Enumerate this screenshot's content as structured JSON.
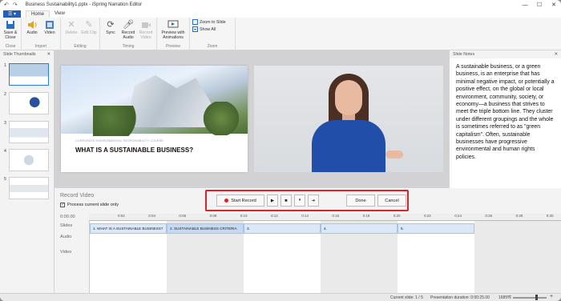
{
  "titlebar": {
    "title": "Business Sustainability1.pptx - iSpring Narration Editor",
    "undo_icon": "↶",
    "redo_icon": "↷",
    "minimize": "—",
    "maximize": "☐",
    "close": "✕"
  },
  "tabs": {
    "file": "☰ ▾",
    "home": "Home",
    "view": "View"
  },
  "ribbon": {
    "close_group": {
      "label": "Close",
      "save_close": "Save & Close"
    },
    "import_group": {
      "label": "Import",
      "audio": "Audio",
      "video": "Video"
    },
    "editing_group": {
      "label": "Editing",
      "delete": "Delete",
      "edit_clip": "Edit Clip"
    },
    "timing_group": {
      "label": "Timing",
      "sync": "Sync",
      "record_audio": "Record Audio",
      "record_video": "Record Video"
    },
    "preview_group": {
      "label": "Preview",
      "preview": "Preview with Animations"
    },
    "zoom_group": {
      "label": "Zoom",
      "zoom_to_slide": "Zoom to Slide",
      "show_all": "Show All"
    }
  },
  "thumbnails": {
    "header": "Slide Thumbnails",
    "items": [
      "1",
      "2",
      "3",
      "4",
      "5"
    ]
  },
  "slide": {
    "caption": "CORPORATE ENVIRONMENTAL RESPONSIBILITY COURSE",
    "title": "WHAT IS A SUSTAINABLE BUSINESS?"
  },
  "notes": {
    "header": "Slide Notes",
    "text": "A sustainable business, or a green business, is an enterprise that has minimal negative impact, or potentially a positive effect, on the global or local environment, community, society, or economy—a business that strives to meet the triple bottom line. They cluster under different groupings and the whole is sometimes referred to as \"green capitalism\". Often, sustainable businesses have progressive environmental and human rights policies."
  },
  "record": {
    "title": "Record Video",
    "process_label": "Process current slide only",
    "start": "Start Record",
    "play": "▶",
    "stop": "■",
    "pause": "⏸",
    "next": "➔",
    "done": "Done",
    "cancel": "Cancel"
  },
  "timeline": {
    "time_label": "0:00.00",
    "slides_label": "Slides",
    "audio_label": "Audio",
    "video_label": "Video",
    "ticks": [
      "0:02",
      "0:04",
      "0:06",
      "0:08",
      "0:10",
      "0:12",
      "0:14",
      "0:16",
      "0:18",
      "0:20",
      "0:22",
      "0:24",
      "0:26",
      "0:28",
      "0:30"
    ],
    "clips": [
      "1. WHAT IS A SUSTAINABLE BUSINESS?",
      "2. SUSTAINABLE BUSINESS CRITERIA",
      "3.",
      "4.",
      "5."
    ]
  },
  "status": {
    "current_slide": "Current slide: 1 / 5",
    "duration": "Presentation duration: 0:00:25.00",
    "zoom": "1685%",
    "minus": "−",
    "plus": "+"
  }
}
